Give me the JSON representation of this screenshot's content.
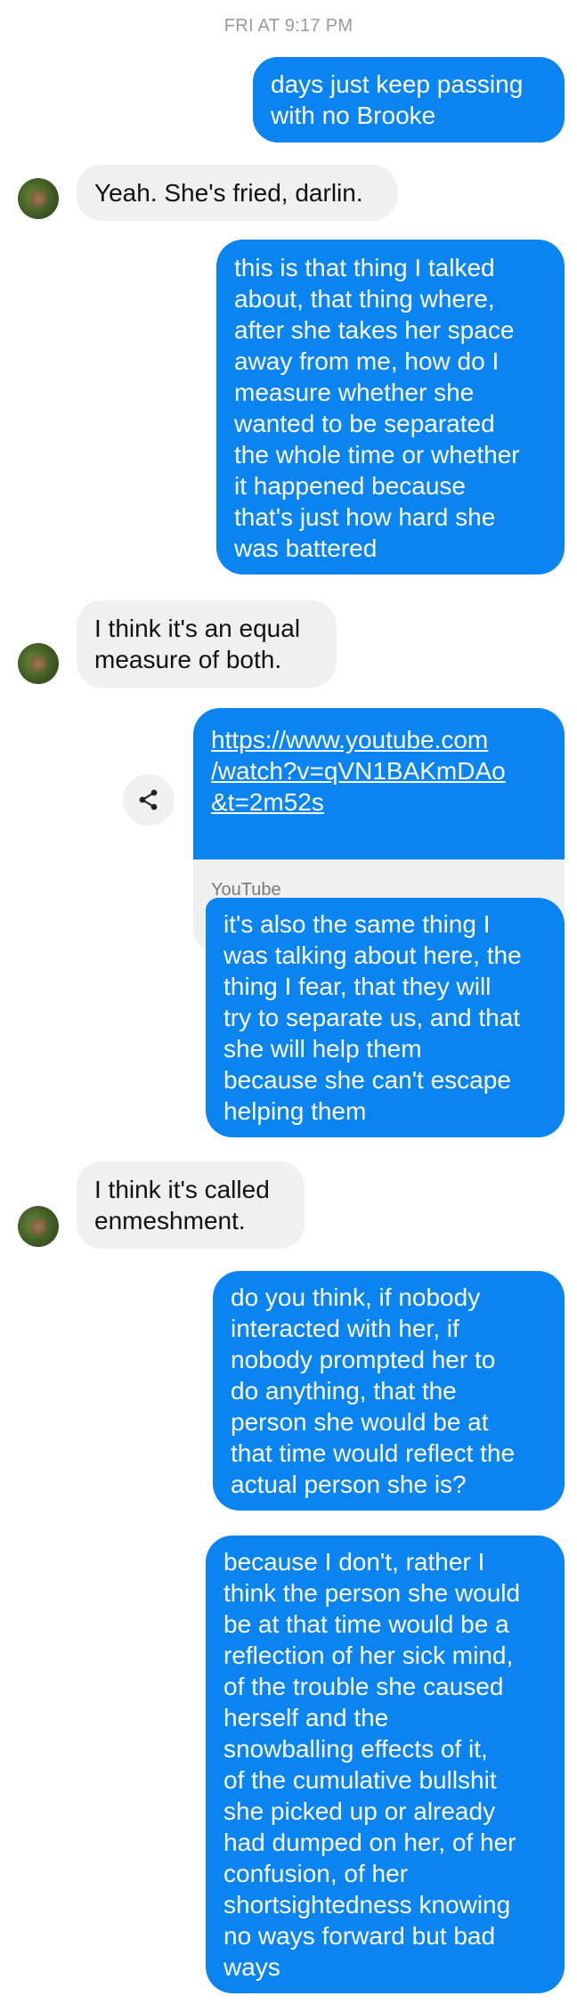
{
  "timestamp": "FRI AT 9:17 PM",
  "messages": [
    {
      "text": "days just keep passing\nwith no Brooke"
    },
    {
      "text": "Yeah. She's fried, darlin."
    },
    {
      "text": "this is that thing I talked\nabout, that thing where,\nafter she takes her space\naway from me, how do I\nmeasure whether she\nwanted to be separated\nthe whole time or whether\nit happened because\nthat's just how hard she\nwas battered"
    },
    {
      "text": "I think it's an equal\nmeasure of both."
    },
    {
      "link": "https://www.youtube.com\n/watch?v=qVN1BAKmDAo\n&t=2m52s",
      "source": "YouTube"
    },
    {
      "text": "it's also the same thing I\nwas talking about here, the\nthing I fear, that they will\ntry to separate us, and that\nshe will help them\nbecause she can't escape\nhelping them"
    },
    {
      "text": "I think it's called\nenmeshment."
    },
    {
      "text": "do you think, if nobody\ninteracted with her, if\nnobody prompted her to\ndo anything, that the\nperson she would be at\nthat time would reflect the\nactual person she is?"
    },
    {
      "text": "because I don't, rather I\nthink the person she would\nbe at that time would be a\nreflection of her sick mind,\nof the trouble she caused\nherself and the\nsnowballing effects of it,\nof the cumulative bullshit\nshe picked up or already\nhad dumped on her, of her\nconfusion, of her\nshortsightedness knowing\nno ways forward but bad\nways"
    }
  ],
  "colors": {
    "outgoing": "#0a84f0",
    "incoming": "#f0f0f0",
    "timestamp": "#9a9a9a"
  },
  "icons": {
    "share": "share-icon",
    "avatar": "contact-avatar"
  }
}
